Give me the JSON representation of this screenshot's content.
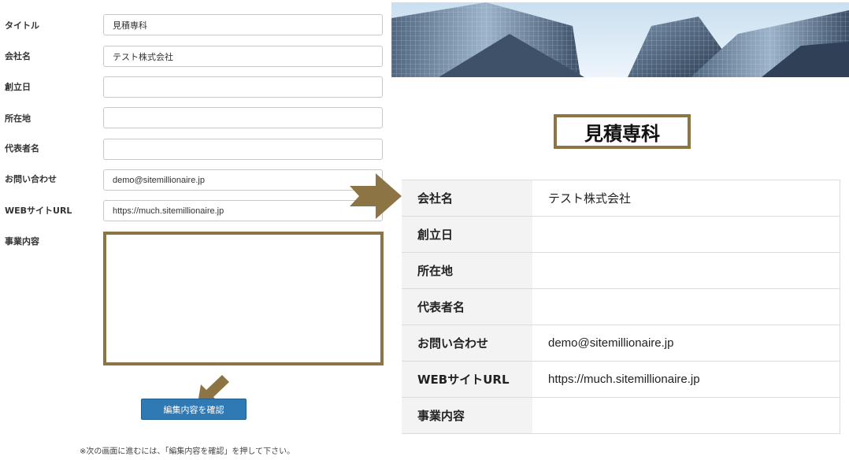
{
  "form": {
    "fields": [
      {
        "label": "タイトル",
        "value": "見積専科",
        "placeholder": ""
      },
      {
        "label": "会社名",
        "value": "テスト株式会社",
        "placeholder": ""
      },
      {
        "label": "創立日",
        "value": "",
        "placeholder": ""
      },
      {
        "label": "所在地",
        "value": "",
        "placeholder": ""
      },
      {
        "label": "代表者名",
        "value": "",
        "placeholder": ""
      },
      {
        "label": "お問い合わせ",
        "value": "demo@sitemillionaire.jp",
        "placeholder": ""
      },
      {
        "label": "WEBサイトURL",
        "value": "https://much.sitemillionaire.jp",
        "placeholder": ""
      }
    ],
    "business_label": "事業内容",
    "business_value": "",
    "confirm_button": "編集内容を確認",
    "note": "※次の画面に進むには、「編集内容を確認」を押して下さい。"
  },
  "preview": {
    "title": "見積専科",
    "rows": [
      {
        "label": "会社名",
        "value": "テスト株式会社"
      },
      {
        "label": "創立日",
        "value": ""
      },
      {
        "label": "所在地",
        "value": ""
      },
      {
        "label": "代表者名",
        "value": ""
      },
      {
        "label": "お問い合わせ",
        "value": "demo@sitemillionaire.jp"
      },
      {
        "label": "WEBサイトURL",
        "value": "https://much.sitemillionaire.jp"
      },
      {
        "label": "事業内容",
        "value": ""
      }
    ]
  },
  "colors": {
    "accent_gold": "#8c7444",
    "button_blue": "#2f79b5"
  }
}
